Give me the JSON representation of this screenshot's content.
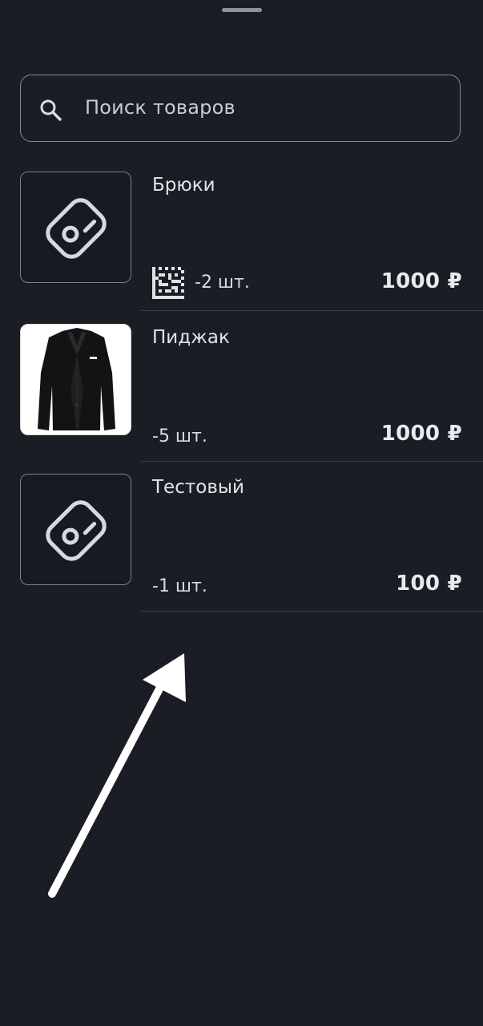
{
  "search": {
    "placeholder": "Поиск товаров"
  },
  "items": [
    {
      "name": "Брюки",
      "quantity": "-2 шт.",
      "price": "1000 ₽",
      "image": "tag-icon",
      "has_datamatrix": true
    },
    {
      "name": "Пиджак",
      "quantity": "-5 шт.",
      "price": "1000 ₽",
      "image": "jacket-photo"
    },
    {
      "name": "Тестовый",
      "quantity": "-1 шт.",
      "price": "100 ₽",
      "image": "tag-icon"
    }
  ],
  "icons": {
    "search": "search-icon",
    "placeholder_image": "tag-icon",
    "code": "datamatrix-icon"
  },
  "colors": {
    "background": "#1b1d24",
    "text": "#e6e8ee",
    "divider": "#3a3e48"
  }
}
